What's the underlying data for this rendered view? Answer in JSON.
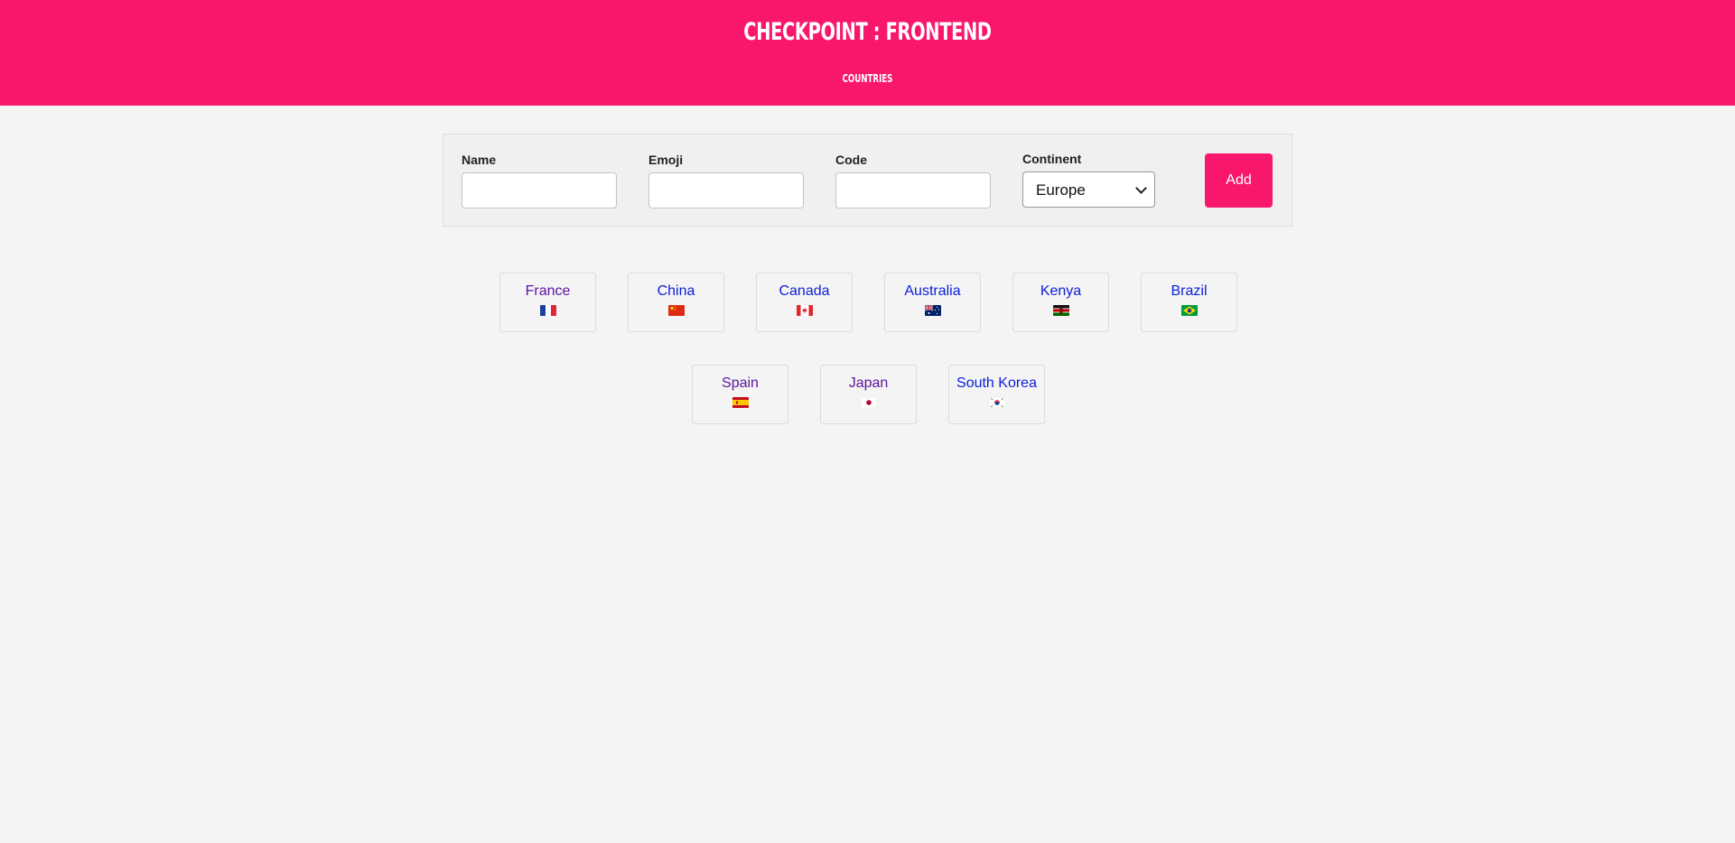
{
  "header": {
    "title": "CHECKPOINT : FRONTEND",
    "subtitle": "COUNTRIES"
  },
  "form": {
    "name_label": "Name",
    "emoji_label": "Emoji",
    "code_label": "Code",
    "continent_label": "Continent",
    "continent_value": "Europe",
    "add_label": "Add",
    "name_value": "",
    "emoji_value": "",
    "code_value": ""
  },
  "countries": [
    {
      "name": "France",
      "flag_icon": "france-flag-icon"
    },
    {
      "name": "China",
      "flag_icon": "china-flag-icon"
    },
    {
      "name": "Canada",
      "flag_icon": "canada-flag-icon"
    },
    {
      "name": "Australia",
      "flag_icon": "australia-flag-icon"
    },
    {
      "name": "Kenya",
      "flag_icon": "kenya-flag-icon"
    },
    {
      "name": "Brazil",
      "flag_icon": "brazil-flag-icon"
    },
    {
      "name": "Spain",
      "flag_icon": "spain-flag-icon"
    },
    {
      "name": "Japan",
      "flag_icon": "japan-flag-icon"
    },
    {
      "name": "South Korea",
      "flag_icon": "south-korea-flag-icon"
    }
  ],
  "colors": {
    "accent": "#f8176c",
    "background": "#f4f4f4",
    "visited_link": "#5b13a0",
    "link": "#0b1ed6"
  }
}
